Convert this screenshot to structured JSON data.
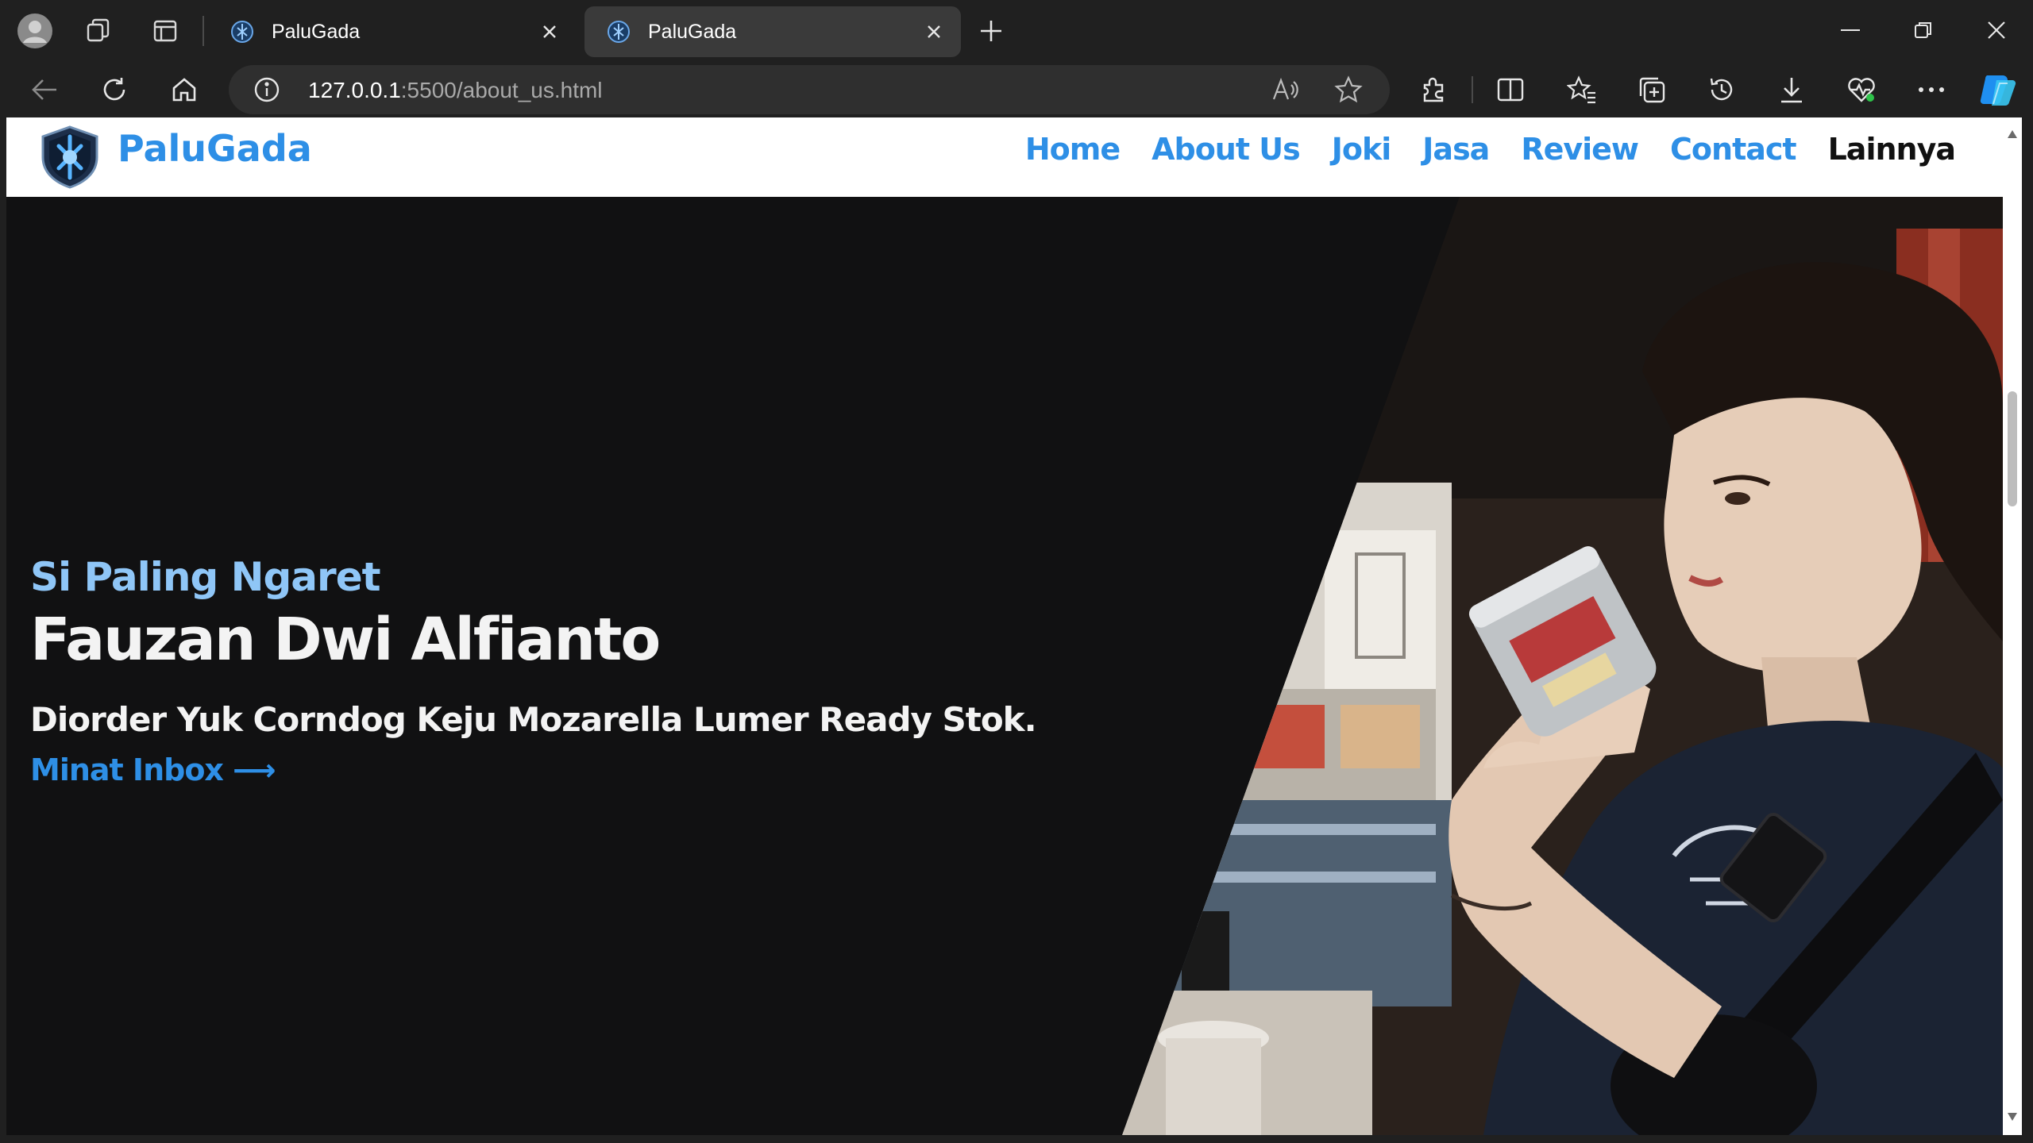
{
  "browser": {
    "tabs": [
      {
        "title": "PaluGada",
        "active": false
      },
      {
        "title": "PaluGada",
        "active": true
      }
    ],
    "url_host": "127.0.0.1",
    "url_rest": ":5500/about_us.html",
    "accent": "#3b8cf7"
  },
  "site": {
    "brand": "PaluGada",
    "menu": [
      "Home",
      "About Us",
      "Joki",
      "Jasa",
      "Review",
      "Contact",
      "Lainnya"
    ],
    "brand_color": "#2e8fe6"
  },
  "hero": {
    "subtitle": "Si Paling Ngaret",
    "name": "Fauzan Dwi Alfianto",
    "tagline": "Diorder Yuk Corndog Keju Mozarella Lumer Ready Stok.",
    "cta": "Minat Inbox ⟶"
  }
}
